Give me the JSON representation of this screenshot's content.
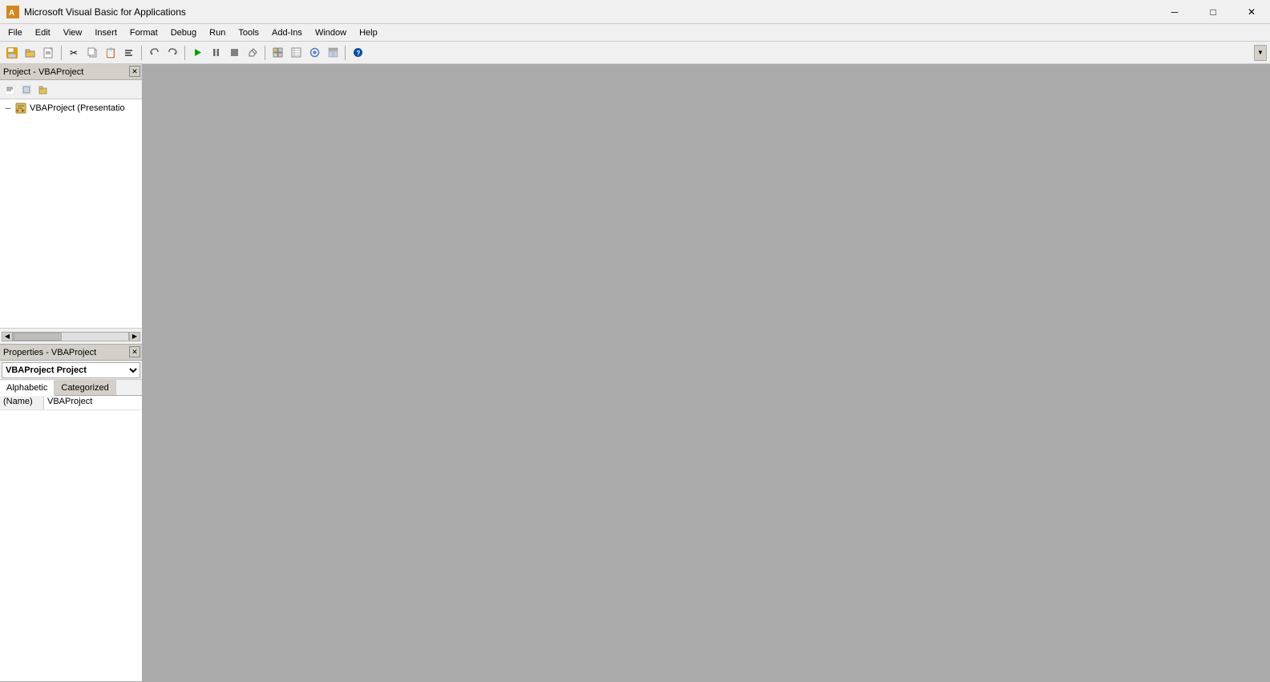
{
  "titleBar": {
    "icon": "VB",
    "title": "Microsoft Visual Basic for Applications",
    "minimize": "─",
    "maximize": "□",
    "close": "✕"
  },
  "menuBar": {
    "items": [
      "File",
      "Edit",
      "View",
      "Insert",
      "Format",
      "Debug",
      "Run",
      "Tools",
      "Add-Ins",
      "Window",
      "Help"
    ]
  },
  "toolbar": {
    "buttons": [
      "💾",
      "📁",
      "✂️",
      "📋",
      "↩",
      "↪",
      "▶",
      "⏸",
      "⏹",
      "⬛",
      "🔧",
      "🛡️",
      "🔍",
      "❓"
    ],
    "separators": [
      2,
      5,
      9,
      13
    ]
  },
  "projectPanel": {
    "title": "Project - VBAProject",
    "treeItems": [
      {
        "label": "VBAProject (Presentatio",
        "icon": "⚙️",
        "expanded": true,
        "indent": 0
      }
    ]
  },
  "propertiesPanel": {
    "title": "Properties - VBAProject",
    "dropdown": {
      "label": "VBAProject",
      "sublabel": "Project"
    },
    "tabs": [
      {
        "label": "Alphabetic",
        "active": true
      },
      {
        "label": "Categorized",
        "active": false
      }
    ],
    "properties": [
      {
        "name": "(Name)",
        "value": "VBAProject"
      }
    ]
  }
}
